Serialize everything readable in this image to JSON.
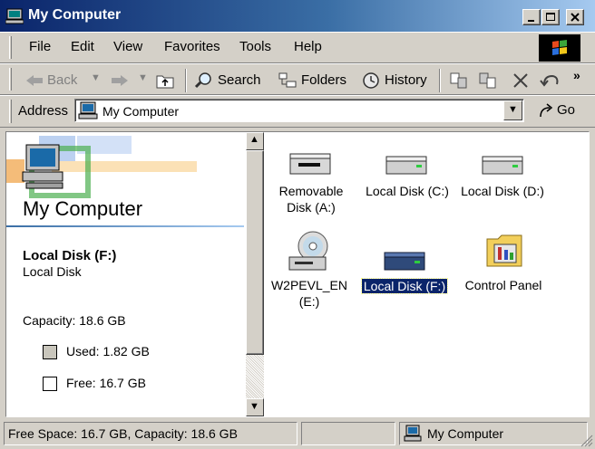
{
  "window": {
    "title": "My Computer",
    "controls": [
      "minimize",
      "maximize",
      "close"
    ]
  },
  "menu": {
    "items": [
      "File",
      "Edit",
      "View",
      "Favorites",
      "Tools",
      "Help"
    ]
  },
  "toolbar": {
    "back_label": "Back",
    "search_label": "Search",
    "folders_label": "Folders",
    "history_label": "History"
  },
  "address": {
    "label": "Address",
    "value": "My Computer",
    "go_label": "Go"
  },
  "left_pane": {
    "heading": "My Computer",
    "selected_name": "Local Disk (F:)",
    "selected_type": "Local Disk",
    "capacity": "Capacity: 18.6 GB",
    "used": "Used: 1.82 GB",
    "free": "Free: 16.7 GB",
    "used_fraction": 0.098
  },
  "items": [
    {
      "label_line1": "Removable",
      "label_line2": "Disk (A:)",
      "icon": "floppy-drive-icon"
    },
    {
      "label_line1": "Local Disk (C:)",
      "label_line2": "",
      "icon": "hard-disk-icon"
    },
    {
      "label_line1": "Local Disk (D:)",
      "label_line2": "",
      "icon": "hard-disk-icon"
    },
    {
      "label_line1": "W2PEVL_EN",
      "label_line2": "(E:)",
      "icon": "cd-drive-icon"
    },
    {
      "label_line1": "Local Disk (F:)",
      "label_line2": "",
      "icon": "hard-disk-icon",
      "selected": true
    },
    {
      "label_line1": "Control Panel",
      "label_line2": "",
      "icon": "control-panel-icon"
    }
  ],
  "status": {
    "text": "Free Space: 16.7 GB, Capacity: 18.6 GB",
    "zone": "My Computer"
  },
  "colors": {
    "title_gradient_start": "#0a246a",
    "title_gradient_end": "#a6caf0",
    "selection": "#0a246a",
    "face": "#d4d0c8",
    "used_swatch": "#c9c6bc"
  }
}
